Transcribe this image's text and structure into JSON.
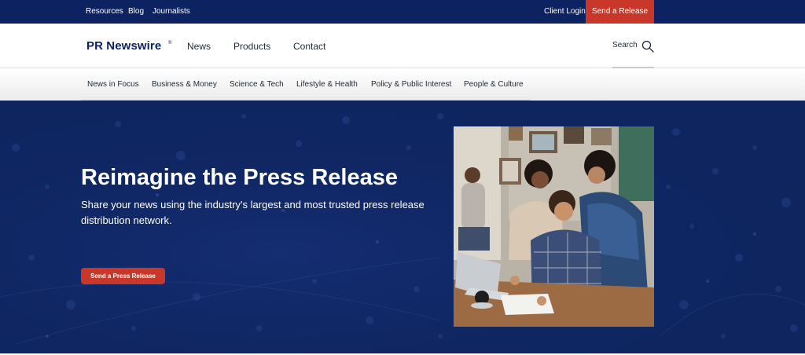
{
  "topbar": {
    "links": [
      "Resources",
      "Blog",
      "Journalists"
    ],
    "client_login": "Client Login",
    "send_release": "Send a Release"
  },
  "mainnav": {
    "logo": "PR Newswire",
    "logo_mark": "®",
    "items": [
      "News",
      "Products",
      "Contact"
    ],
    "search_label": "Search",
    "search_icon": "search-icon"
  },
  "categories": [
    "News in Focus",
    "Business & Money",
    "Science & Tech",
    "Lifestyle & Health",
    "Policy & Public Interest",
    "People & Culture"
  ],
  "hero": {
    "title": "Reimagine the Press Release",
    "subtitle": "Share your news using the industry's largest and most trusted press release distribution network.",
    "cta": "Send a Press Release"
  },
  "colors": {
    "navy": "#0d2260",
    "hero_navy": "#0e2560",
    "accent_red": "#c8372a"
  }
}
